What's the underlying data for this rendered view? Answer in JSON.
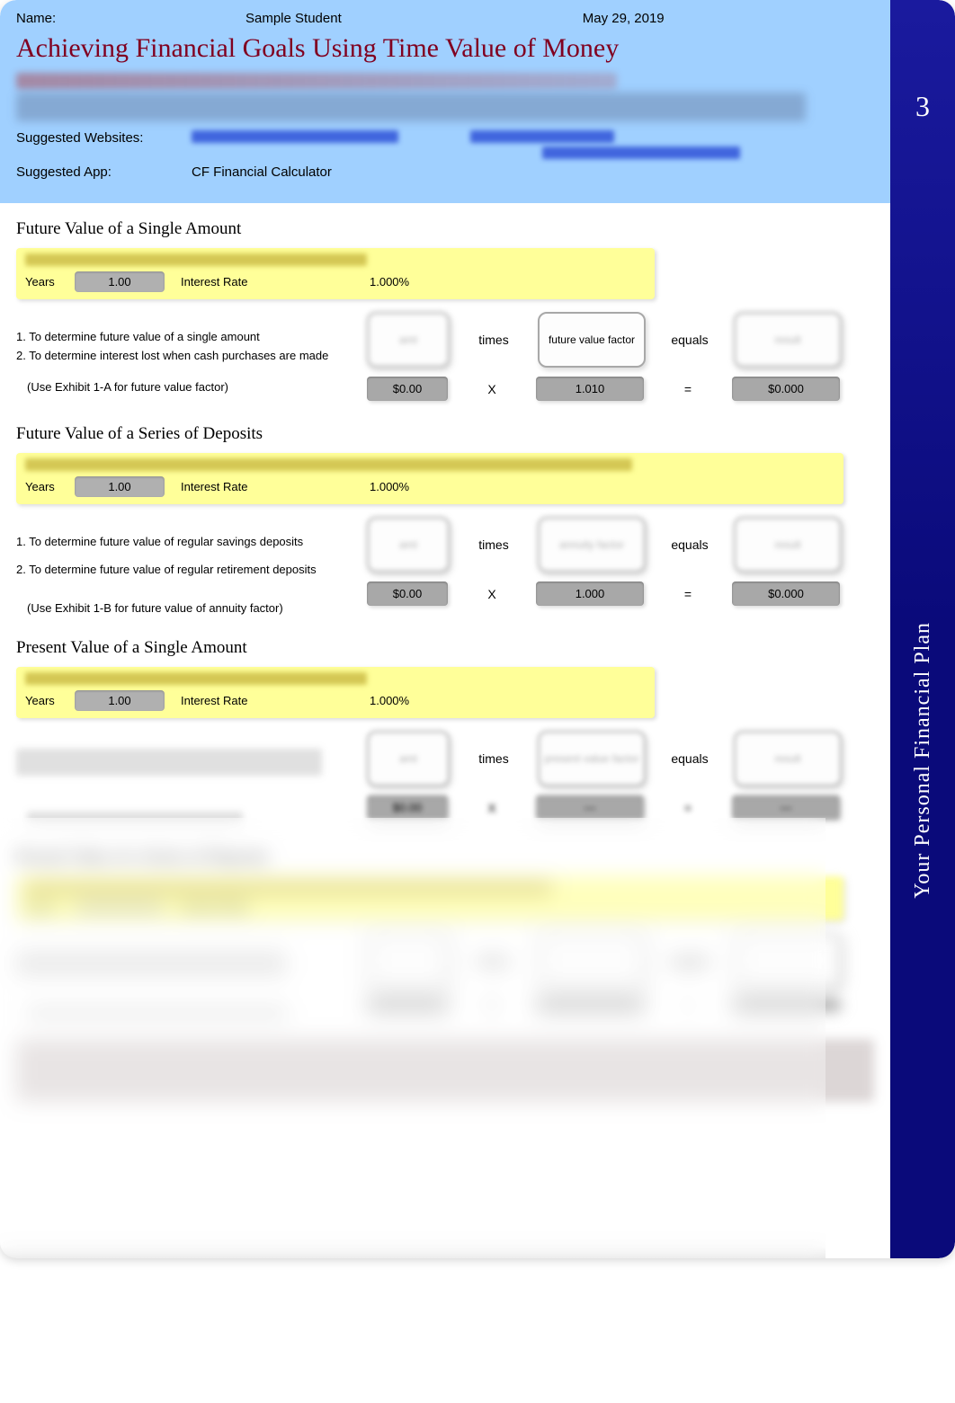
{
  "header": {
    "name_label": "Name:",
    "student": "Sample Student",
    "date": "May 29, 2019",
    "title": "Achieving Financial Goals Using Time Value of Money",
    "suggested_websites_label": "Suggested Websites:",
    "suggested_app_label": "Suggested App:",
    "suggested_app_value": "CF Financial Calculator"
  },
  "sidebar": {
    "page_number": "3",
    "title": "Your Personal Financial Plan"
  },
  "sections": {
    "fv_single": {
      "title": "Future Value of a Single Amount",
      "years_label": "Years",
      "years_value": "1.00",
      "rate_label": "Interest Rate",
      "rate_value": "1.000%",
      "item1": "1. To determine future value of a single amount",
      "item2": "2. To determine interest lost when cash purchases are made",
      "exhibit_note": "(Use Exhibit 1-A for future value factor)",
      "times": "times",
      "equals": "equals",
      "fv_factor_label": "future value factor",
      "row_dollar": "$0.00",
      "row_x": "X",
      "row_factor": "1.010",
      "row_eq": "=",
      "row_result": "$0.000"
    },
    "fv_series": {
      "title": "Future Value of a Series of Deposits",
      "years_label": "Years",
      "years_value": "1.00",
      "rate_label": "Interest Rate",
      "rate_value": "1.000%",
      "item1": "1. To determine future value of regular savings deposits",
      "item2": "2. To determine future value of regular retirement deposits",
      "exhibit_note": "(Use Exhibit 1-B for future value of annuity factor)",
      "times": "times",
      "equals": "equals",
      "row_dollar": "$0.00",
      "row_x": "X",
      "row_factor": "1.000",
      "row_eq": "=",
      "row_result": "$0.000"
    },
    "pv_single": {
      "title": "Present Value of a Single Amount",
      "years_label": "Years",
      "years_value": "1.00",
      "rate_label": "Interest Rate",
      "rate_value": "1.000%",
      "times": "times",
      "equals": "equals"
    },
    "pv_series": {
      "title": "Present Value of a Series of Deposits"
    }
  }
}
